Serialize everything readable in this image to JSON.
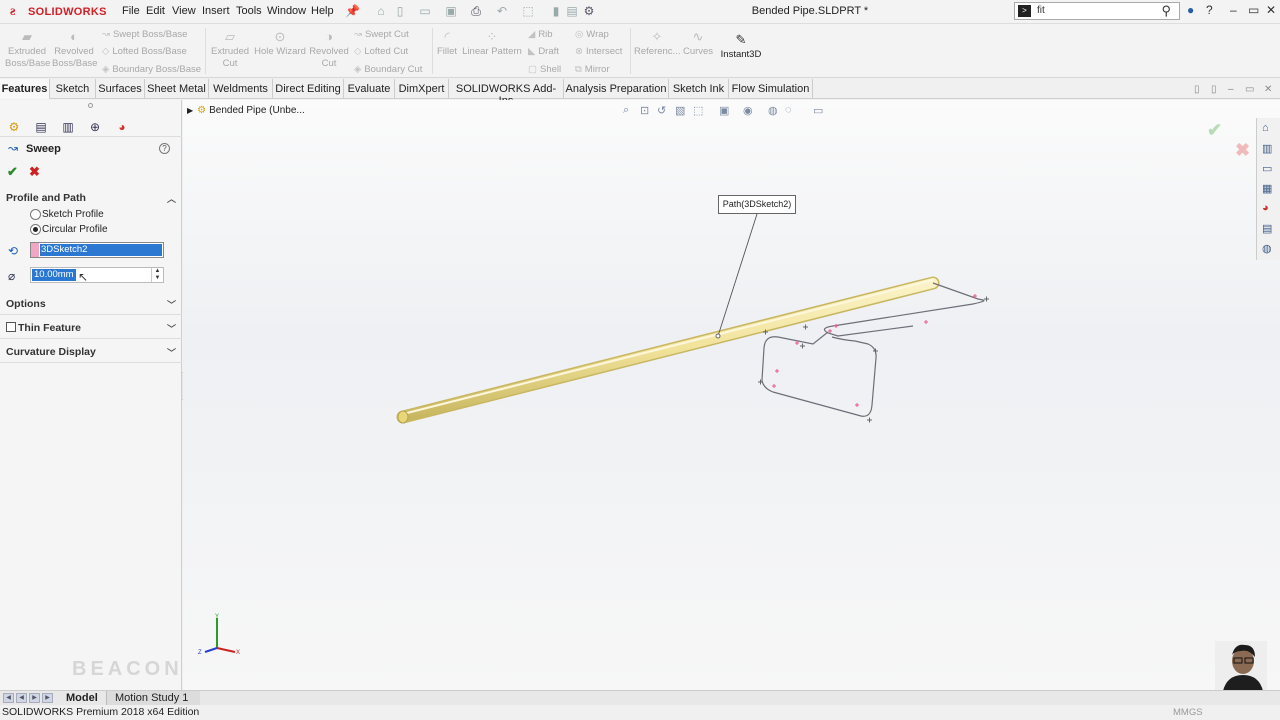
{
  "app": {
    "brand": "SOLIDWORKS",
    "document_title": "Bended Pipe.SLDPRT *"
  },
  "menu": {
    "items": [
      "File",
      "Edit",
      "View",
      "Insert",
      "Tools",
      "Window",
      "Help"
    ]
  },
  "search": {
    "value": "fit"
  },
  "ribbon": {
    "extruded_boss": "Extruded Boss/Base",
    "revolved_boss": "Revolved Boss/Base",
    "swept_boss": "Swept Boss/Base",
    "lofted_boss": "Lofted Boss/Base",
    "boundary_boss": "Boundary Boss/Base",
    "extruded_cut": "Extruded Cut",
    "hole_wizard": "Hole Wizard",
    "revolved_cut": "Revolved Cut",
    "swept_cut": "Swept Cut",
    "lofted_cut": "Lofted Cut",
    "boundary_cut": "Boundary Cut",
    "fillet": "Fillet",
    "linear_pattern": "Linear Pattern",
    "rib": "Rib",
    "draft": "Draft",
    "shell": "Shell",
    "wrap": "Wrap",
    "intersect": "Intersect",
    "mirror": "Mirror",
    "reference": "Referenc...",
    "curves": "Curves",
    "instant3d": "Instant3D"
  },
  "tabs": [
    "Features",
    "Sketch",
    "Surfaces",
    "Sheet Metal",
    "Weldments",
    "Direct Editing",
    "Evaluate",
    "DimXpert",
    "SOLIDWORKS Add-Ins",
    "Analysis Preparation",
    "Sketch Ink",
    "Flow Simulation"
  ],
  "property_manager": {
    "title": "Sweep",
    "profile_and_path": "Profile and Path",
    "sketch_profile": "Sketch Profile",
    "circular_profile": "Circular Profile",
    "path_value": "3DSketch2",
    "diameter_value": "10.00mm",
    "options": "Options",
    "thin_feature": "Thin Feature",
    "curvature_display": "Curvature Display",
    "selected_profile": "circular"
  },
  "viewport": {
    "tree_node": "Bended Pipe  (Unbe...",
    "callout": "Path(3DSketch2)"
  },
  "watermark": "BEACON",
  "bottom_tabs": [
    "Model",
    "Motion Study 1"
  ],
  "status": {
    "edition": "SOLIDWORKS Premium 2018 x64 Edition",
    "units": "MMGS"
  },
  "colors": {
    "brand_red": "#d01f26",
    "selection_blue": "#2a78d1",
    "pipe_yellow": "#f3e7a6",
    "sketch_pink": "#ee5588"
  }
}
